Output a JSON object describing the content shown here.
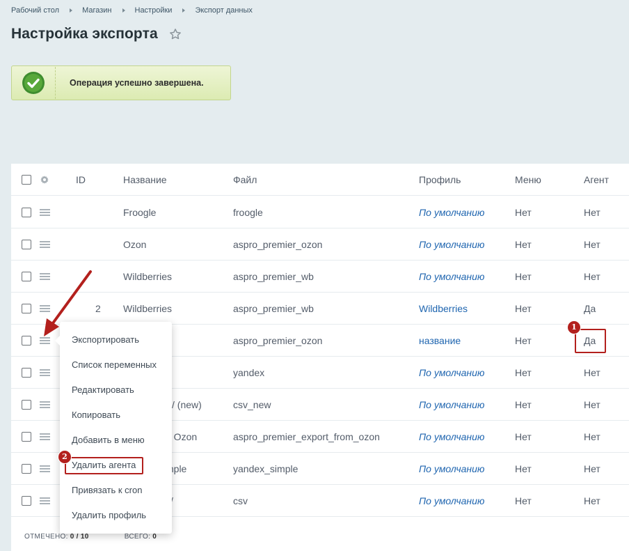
{
  "breadcrumb": [
    "Рабочий стол",
    "Магазин",
    "Настройки",
    "Экспорт данных"
  ],
  "page": {
    "title": "Настройка экспорта"
  },
  "notification": {
    "text": "Операция успешно завершена."
  },
  "table": {
    "columns": {
      "id": "ID",
      "name": "Название",
      "file": "Файл",
      "profile": "Профиль",
      "menu": "Меню",
      "agent": "Агент"
    },
    "rows": [
      {
        "id": "",
        "name": "Froogle",
        "file": "froogle",
        "profile": "По умолчанию",
        "menu": "Нет",
        "agent": "Нет"
      },
      {
        "id": "",
        "name": "Ozon",
        "file": "aspro_premier_ozon",
        "profile": "По умолчанию",
        "menu": "Нет",
        "agent": "Нет"
      },
      {
        "id": "",
        "name": "Wildberries",
        "file": "aspro_premier_wb",
        "profile": "По умолчанию",
        "menu": "Нет",
        "agent": "Нет"
      },
      {
        "id": "2",
        "name": "Wildberries",
        "file": "aspro_premier_wb",
        "profile": "Wildberries",
        "menu": "Нет",
        "agent": "Да"
      },
      {
        "id": "",
        "name": "",
        "file": "aspro_premier_ozon",
        "profile": "название",
        "menu": "Нет",
        "agent": "Да"
      },
      {
        "id": "",
        "name": "",
        "file": "yandex",
        "profile": "По умолчанию",
        "menu": "Нет",
        "agent": "Нет"
      },
      {
        "id": "",
        "name": "/ (new)",
        "file": "csv_new",
        "profile": "По умолчанию",
        "menu": "Нет",
        "agent": "Нет"
      },
      {
        "id": "",
        "name": "n Ozon",
        "file": "aspro_premier_export_from_ozon",
        "profile": "По умолчанию",
        "menu": "Нет",
        "agent": "Нет"
      },
      {
        "id": "",
        "name": "mple",
        "file": "yandex_simple",
        "profile": "По умолчанию",
        "menu": "Нет",
        "agent": "Нет"
      },
      {
        "id": "",
        "name": "/",
        "file": "csv",
        "profile": "По умолчанию",
        "menu": "Нет",
        "agent": "Нет"
      }
    ]
  },
  "footer": {
    "selected_label": "ОТМЕЧЕНО:",
    "selected_value": "0 / 10",
    "total_label": "ВСЕГО:",
    "total_value": "0"
  },
  "context_menu": {
    "items": [
      "Экспортировать",
      "Список переменных",
      "Редактировать",
      "Копировать",
      "Добавить в меню",
      "Удалить агента",
      "Привязать к cron",
      "Удалить профиль"
    ]
  },
  "annotations": {
    "badge_1": "1",
    "badge_2": "2",
    "color": "#b3201d"
  }
}
